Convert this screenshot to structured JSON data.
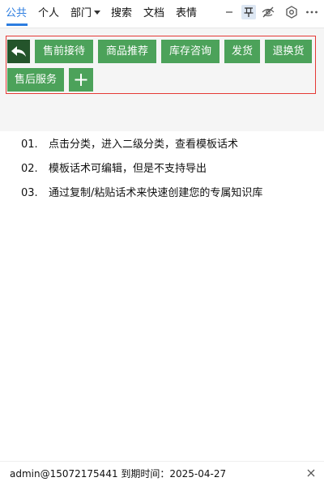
{
  "nav": {
    "tabs": [
      {
        "label": "公共",
        "active": true
      },
      {
        "label": "个人",
        "active": false
      },
      {
        "label": "部门",
        "active": false,
        "dropdown": true
      },
      {
        "label": "搜索",
        "active": false
      },
      {
        "label": "文档",
        "active": false
      },
      {
        "label": "表情",
        "active": false
      }
    ],
    "tools": [
      "minimize-icon",
      "pin-icon",
      "hide-icon",
      "settings-icon",
      "more-icon"
    ]
  },
  "templates": {
    "back_icon": "back-arrow-icon",
    "categories": [
      "售前接待",
      "商品推荐",
      "库存咨询",
      "发货",
      "退换货",
      "售后服务"
    ],
    "add_icon": "plus-icon",
    "colors": {
      "button": "#4ca25a",
      "back_button": "#24542b",
      "highlight_border": "#e53935"
    }
  },
  "tips": [
    {
      "num": "01.",
      "text": "点击分类，进入二级分类，查看模板话术"
    },
    {
      "num": "02.",
      "text": "模板话术可编辑，但是不支持导出"
    },
    {
      "num": "03.",
      "text": "通过复制/粘贴话术来快速创建您的专属知识库"
    }
  ],
  "footer": {
    "text": "admin@15072175441  到期时间：2025-04-27",
    "close_icon": "close-icon"
  },
  "colors": {
    "accent": "#2c7de0"
  }
}
